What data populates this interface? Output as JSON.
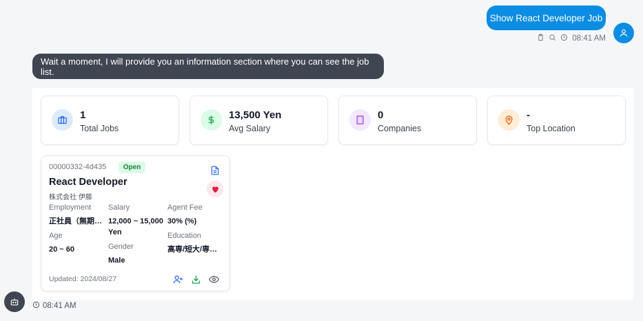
{
  "user_message": {
    "text": "Show React Developer Job",
    "time": "08:41 AM",
    "icons": [
      "clipboard-icon",
      "search-icon",
      "clock-icon"
    ]
  },
  "bot_message": {
    "text": "Wait a moment, I will provide you an information section where you can see the job list.",
    "time": "08:41 AM"
  },
  "stats": [
    {
      "value": "1",
      "label": "Total Jobs",
      "icon": "briefcase-icon",
      "bg": "#dbeafe",
      "color": "#2563eb"
    },
    {
      "value": "13,500 Yen",
      "label": "Avg Salary",
      "icon": "dollar-icon",
      "bg": "#dcfce7",
      "color": "#16a34a"
    },
    {
      "value": "0",
      "label": "Companies",
      "icon": "building-icon",
      "bg": "#f3e8ff",
      "color": "#9333ea"
    },
    {
      "value": "-",
      "label": "Top Location",
      "icon": "map-pin-icon",
      "bg": "#ffedd5",
      "color": "#ea580c"
    }
  ],
  "job": {
    "id": "00000332-4d435",
    "status": "Open",
    "title": "React Developer",
    "company": "株式会社 伊藤",
    "employment_label": "Employment",
    "employment_value": "正社員（無期雇用）",
    "salary_label": "Salary",
    "salary_value": "12,000 ~ 15,000 Yen",
    "agent_fee_label": "Agent Fee",
    "agent_fee_value": "30% (%)",
    "age_label": "Age",
    "age_value": "20 ~ 60",
    "gender_label": "Gender",
    "gender_value": "Male",
    "education_label": "Education",
    "education_value": "高専/短大/専門学校卒以上",
    "updated": "Updated: 2024/08/27"
  },
  "colors": {
    "primary": "#0a8de3",
    "bot_bubble": "#3f4652",
    "favorite": "#e11d48"
  }
}
